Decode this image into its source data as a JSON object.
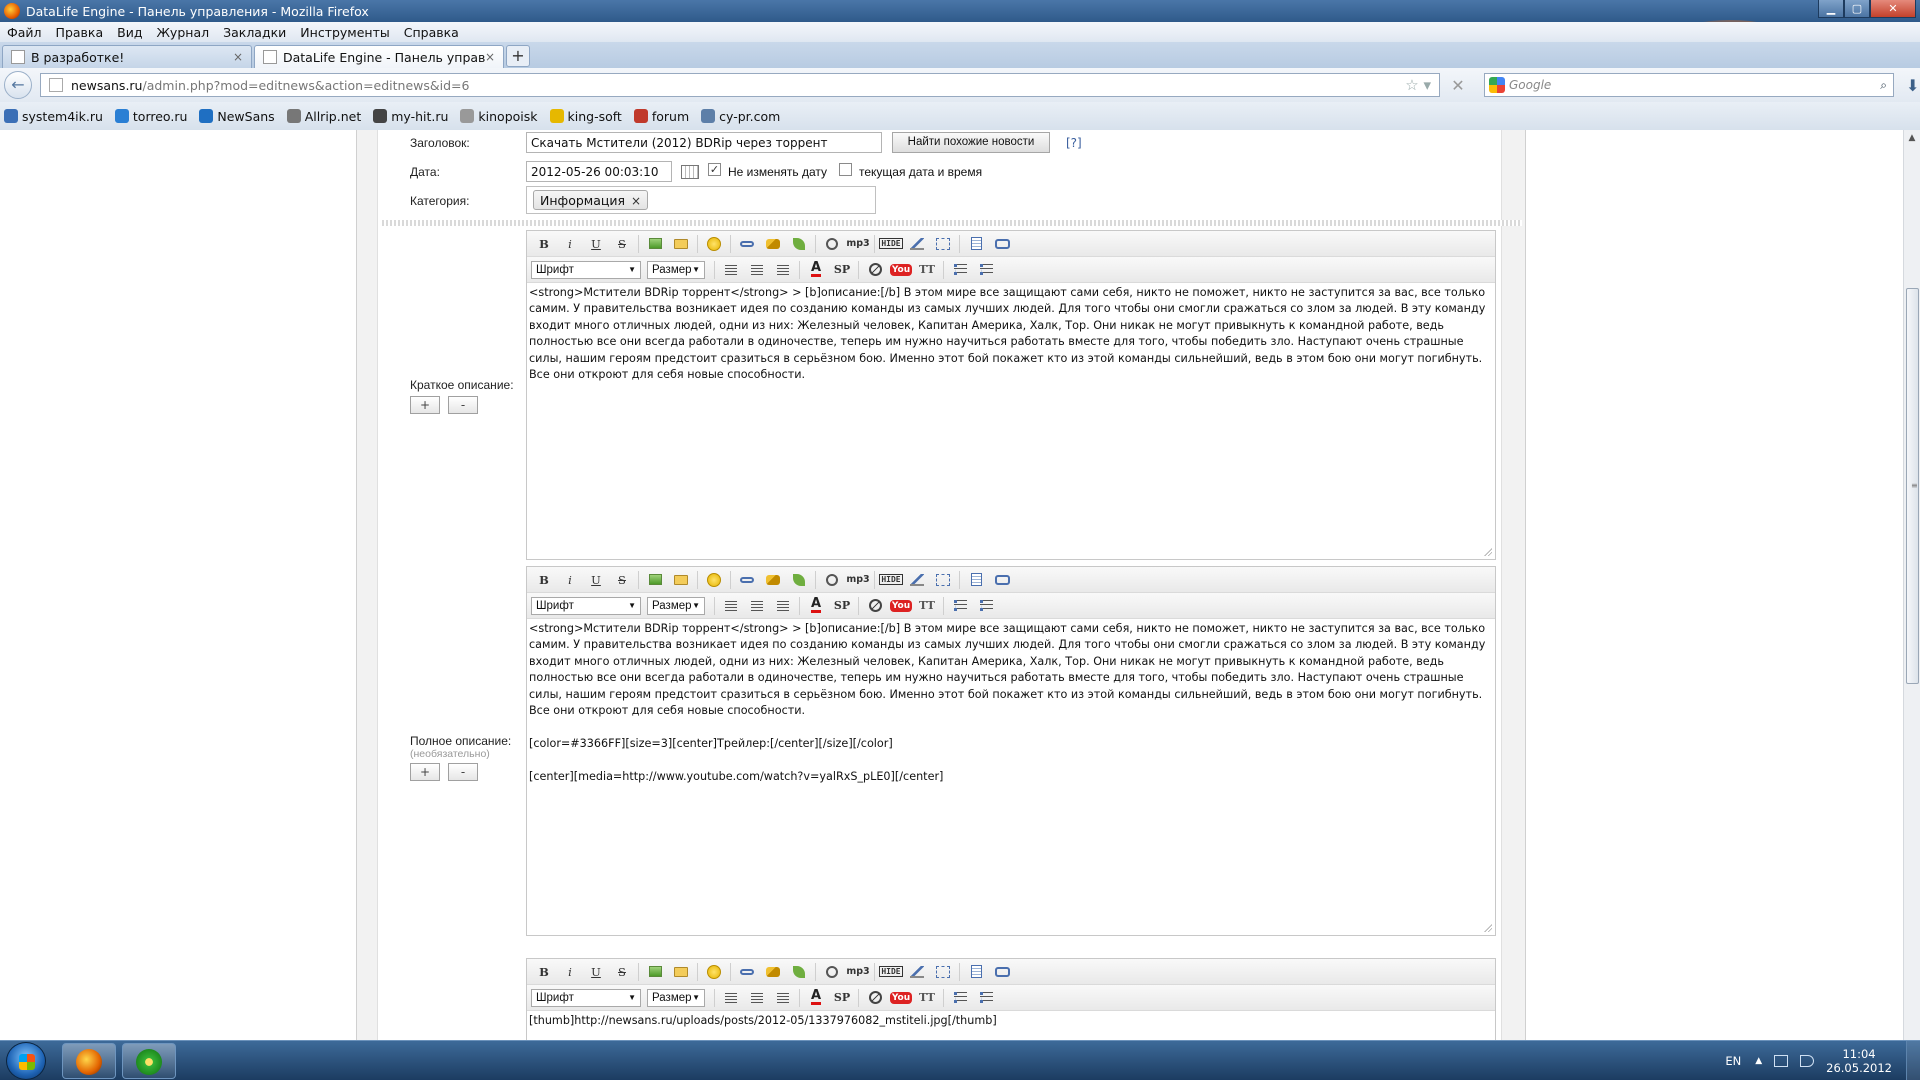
{
  "window": {
    "title": "DataLife Engine - Панель управления - Mozilla Firefox",
    "minimize": "▁",
    "maximize": "▢",
    "close": "✕"
  },
  "menubar": [
    "Файл",
    "Правка",
    "Вид",
    "Журнал",
    "Закладки",
    "Инструменты",
    "Справка"
  ],
  "tabs": [
    {
      "label": "В разработке!",
      "close": "×",
      "active": false
    },
    {
      "label": "DataLife Engine - Панель управления",
      "close": "×",
      "active": true
    }
  ],
  "newtab": "+",
  "navbar": {
    "back": "←",
    "url_host": "newsans.ru",
    "url_path": "/admin.php?mod=editnews&action=editnews&id=6",
    "star": "☆ ▾",
    "stop": "✕",
    "search_placeholder": "Google",
    "search_icon": "⌕",
    "download": "⬇"
  },
  "bookmarks": [
    {
      "label": "system4ik.ru",
      "color": "#3b6fb6"
    },
    {
      "label": "torreo.ru",
      "color": "#2a7fd4"
    },
    {
      "label": "NewSans",
      "color": "#1f6fc2"
    },
    {
      "label": "Allrip.net",
      "color": "#777777"
    },
    {
      "label": "my-hit.ru",
      "color": "#444444"
    },
    {
      "label": "kinopoisk",
      "color": "#999999"
    },
    {
      "label": "king-soft",
      "color": "#e6b800"
    },
    {
      "label": "forum",
      "color": "#c0392b"
    },
    {
      "label": "cy-pr.com",
      "color": "#5d7fa8"
    }
  ],
  "form": {
    "title_label": "Заголовок:",
    "title_value": "Скачать Мстители (2012) BDRip через торрент",
    "find_similar": "Найти похожие новости",
    "help_link": "[?]",
    "date_label": "Дата:",
    "date_value": "2012-05-26 00:03:10",
    "keep_date_label": "Не изменять дату",
    "keep_date_checked": "✓",
    "current_date_label": "текущая дата и время",
    "category_label": "Категория:",
    "category_tag": "Информация",
    "category_remove": "×",
    "short_label": "Краткое описание:",
    "full_label": "Полное описание:",
    "full_sub": "(необязательно)",
    "plus": "+",
    "minus": "-"
  },
  "toolbar": {
    "bold": "B",
    "italic": "i",
    "underline": "U",
    "strike": "S",
    "mp3": "mp3",
    "hide": "HIDE",
    "font_select": "Шрифт",
    "size_select": "Размер",
    "color": "A",
    "spoiler": "SP",
    "youtube": "You",
    "translit": "TT"
  },
  "editors": {
    "short_text": "<strong>Мстители BDRip торрент</strong> > [b]описание:[/b] В этом мире все защищают сами себя, никто не поможет, никто не заступится за вас, все только самим. У правительства возникает идея по созданию команды из самых лучших людей. Для того чтобы они смогли сражаться со злом за людей. В эту команду входит много отличных людей, одни из них: Железный человек, Капитан Америка, Халк, Тор. Они никак не могут привыкнуть к командной работе, ведь полностью все они всегда работали в одиночестве, теперь им нужно научиться работать вместе для того, чтобы победить зло. Наступают очень страшные силы, нашим героям предстоит сразиться в серьёзном бою. Именно этот бой покажет кто из этой команды сильнейший, ведь в этом бою они могут погибнуть. Все они откроют для себя новые способности.",
    "full_text": "<strong>Мстители BDRip торрент</strong> > [b]описание:[/b] В этом мире все защищают сами себя, никто не поможет, никто не заступится за вас, все только самим. У правительства возникает идея по созданию команды из самых лучших людей. Для того чтобы они смогли сражаться со злом за людей. В эту команду входит много отличных людей, одни из них: Железный человек, Капитан Америка, Халк, Тор. Они никак не могут привыкнуть к командной работе, ведь полностью все они всегда работали в одиночестве, теперь им нужно научиться работать вместе для того, чтобы победить зло. Наступают очень страшные силы, нашим героям предстоит сразиться в серьёзном бою. Именно этот бой покажет кто из этой команды сильнейший, ведь в этом бою они могут погибнуть. Все они откроют для себя новые способности.\n\n[color=#3366FF][size=3][center]Трейлер:[/center][/size][/color]\n\n[center][media=http://www.youtube.com/watch?v=yalRxS_pLE0][/center]",
    "third_text": "[thumb]http://newsans.ru/uploads/posts/2012-05/1337976082_mstiteli.jpg[/thumb]"
  },
  "scrollbar": {
    "up": "▲",
    "down": "▼",
    "grip": "≡"
  },
  "taskbar": {
    "lang": "EN",
    "time": "11:04",
    "date": "26.05.2012",
    "tray_arrow": "▲"
  }
}
